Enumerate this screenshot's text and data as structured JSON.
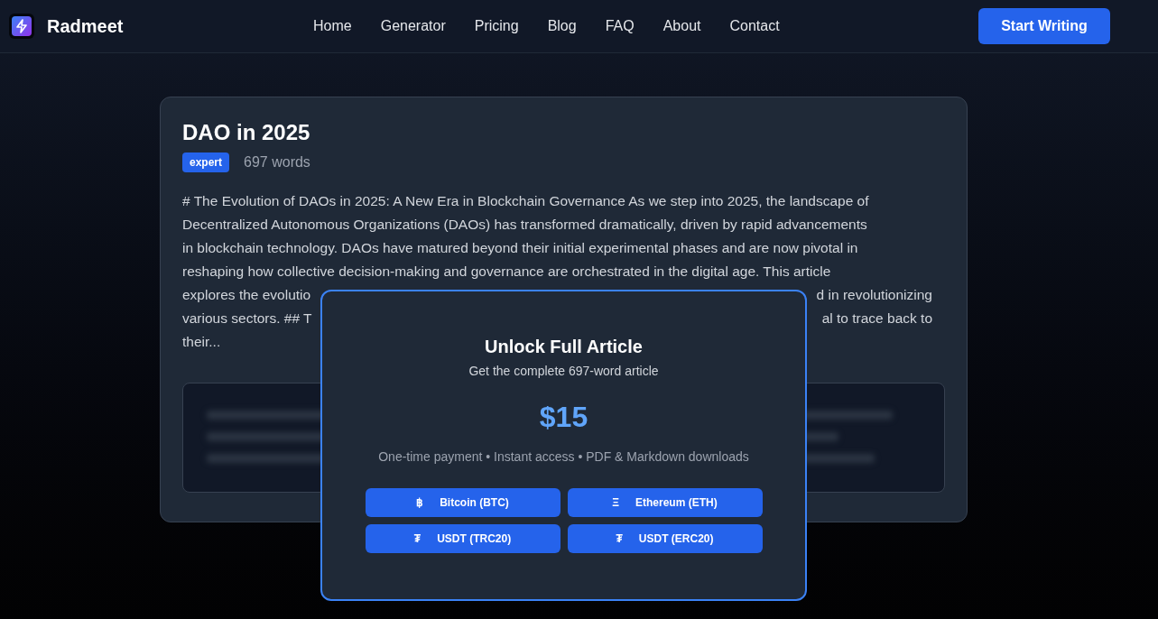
{
  "brand": {
    "name": "Radmeet"
  },
  "nav": {
    "links": [
      "Home",
      "Generator",
      "Pricing",
      "Blog",
      "FAQ",
      "About",
      "Contact"
    ],
    "cta": "Start Writing"
  },
  "article": {
    "title": "DAO in 2025",
    "level_badge": "expert",
    "word_count": "697 words",
    "lines": [
      {
        "left": "# The Evolution of DAOs in 2025: A New Era in Blockchain Governance As we step into 2025, the landscape of"
      },
      {
        "left": "Decentralized Autonomous Organizations (DAOs) has transformed dramatically, driven by rapid advancements"
      },
      {
        "left": "in blockchain technology. DAOs have matured beyond their initial experimental phases and are now pivotal in"
      },
      {
        "left": "reshaping how collective decision-making and governance are orchestrated in the digital age. This article"
      },
      {
        "left": "explores the evolutio",
        "right": "d in revolutionizing"
      },
      {
        "left": "various sectors. ## T",
        "right": "al to trace back to"
      },
      {
        "left": "their..."
      }
    ],
    "locked_preview": {
      "kind": "blurred"
    }
  },
  "paywall": {
    "title": "Unlock Full Article",
    "subtitle": "Get the complete 697-word article",
    "price": "$15",
    "features": "One-time payment • Instant access • PDF & Markdown downloads",
    "payments": [
      {
        "symbol": "฿",
        "label": "Bitcoin (BTC)"
      },
      {
        "symbol": "Ξ",
        "label": "Ethereum (ETH)"
      },
      {
        "symbol": "₮",
        "label": "USDT (TRC20)"
      },
      {
        "symbol": "₮",
        "label": "USDT (ERC20)"
      }
    ]
  }
}
